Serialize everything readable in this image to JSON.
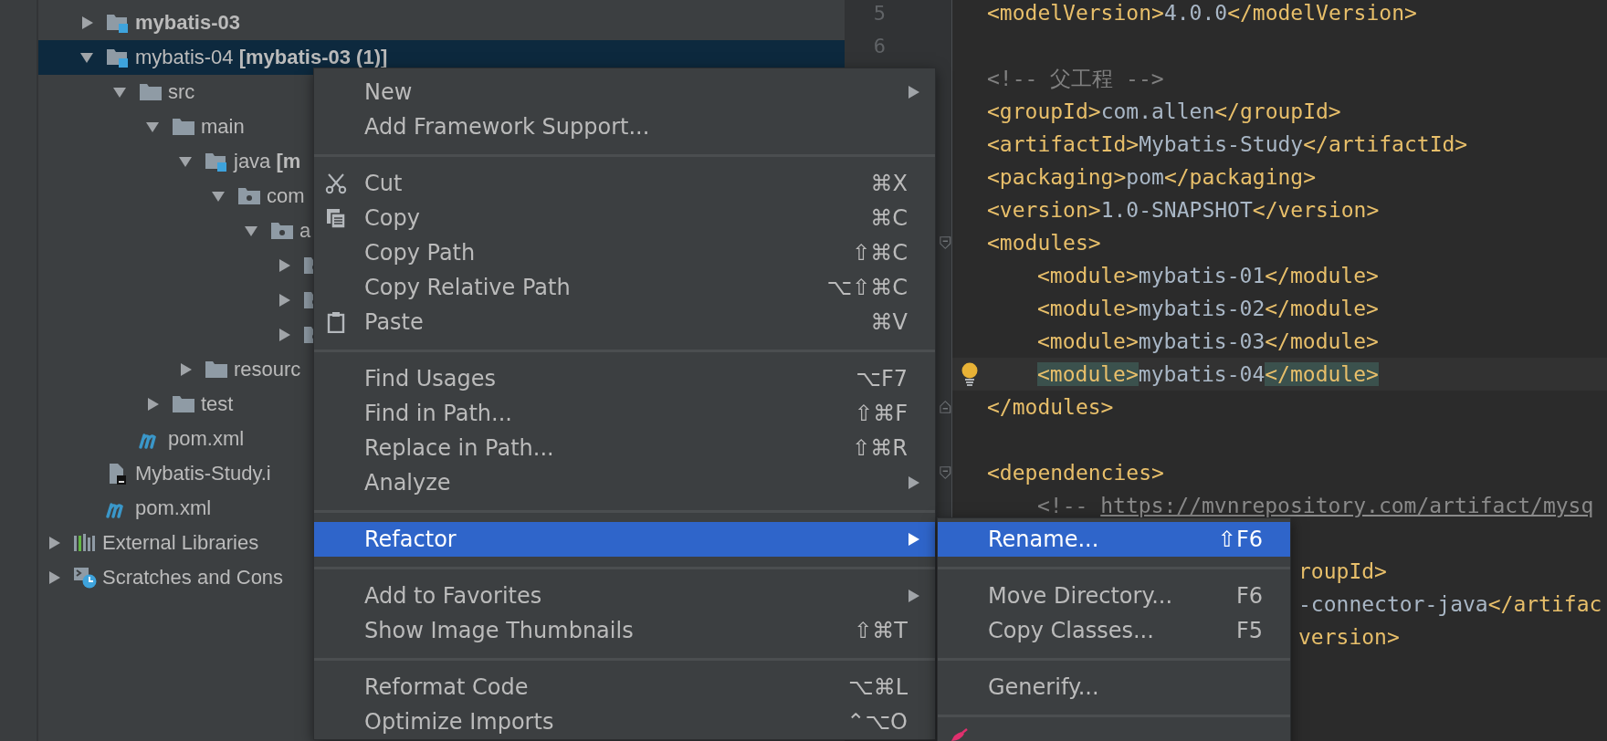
{
  "tree": {
    "items": [
      {
        "label": "mybatis-03",
        "kind": "module",
        "bold": true,
        "expanded": false,
        "selected": false
      },
      {
        "label": "mybatis-04 **[mybatis-03 (1)]**",
        "kind": "module",
        "expanded": true,
        "selected": true,
        "children": [
          {
            "label": "src",
            "kind": "folder",
            "expanded": true,
            "selected": false,
            "children": [
              {
                "label": "main",
                "kind": "folder",
                "expanded": true,
                "selected": false,
                "children": [
                  {
                    "label": "java **[m**",
                    "kind": "module",
                    "expanded": true,
                    "selected": false,
                    "children": [
                      {
                        "label": "com",
                        "kind": "package",
                        "expanded": true,
                        "selected": false,
                        "children": [
                          {
                            "label": "a",
                            "kind": "package",
                            "expanded": true,
                            "selected": false,
                            "children": [
                              {
                                "kind": "package",
                                "expanded": false,
                                "selected": false
                              },
                              {
                                "kind": "package",
                                "expanded": false,
                                "selected": false
                              },
                              {
                                "kind": "package",
                                "expanded": false,
                                "selected": false
                              }
                            ]
                          }
                        ]
                      }
                    ]
                  },
                  {
                    "label": "resourc",
                    "kind": "folder",
                    "expanded": false,
                    "selected": false
                  }
                ]
              },
              {
                "label": "test",
                "kind": "folder",
                "expanded": false,
                "selected": false
              }
            ]
          },
          {
            "label": "pom.xml",
            "kind": "maven",
            "selected": false
          }
        ]
      },
      {
        "label": "Mybatis-Study.i",
        "kind": "iml",
        "selected": false
      },
      {
        "label": "pom.xml",
        "kind": "maven",
        "selected": false
      }
    ],
    "roots": [
      {
        "label": "External Libraries",
        "kind": "libraries",
        "expanded": false,
        "selected": false
      },
      {
        "label": "Scratches and Cons",
        "kind": "scratches",
        "expanded": false,
        "selected": false
      }
    ]
  },
  "editor": {
    "lines": [
      {
        "number": "5",
        "kind": "full",
        "segments": [
          {
            "kind": "tag",
            "text": "<modelVersion>"
          },
          {
            "kind": "text",
            "text": "4.0.0"
          },
          {
            "kind": "tag",
            "text": "</modelVersion>"
          }
        ]
      },
      {
        "number": "6",
        "kind": "blank"
      },
      {
        "kind": "full",
        "segments": [
          {
            "kind": "comment",
            "text": "<!-- 父工程 -->"
          }
        ]
      },
      {
        "kind": "full",
        "segments": [
          {
            "kind": "tag",
            "text": "<groupId>"
          },
          {
            "kind": "text",
            "text": "com.allen"
          },
          {
            "kind": "tag",
            "text": "</groupId>"
          }
        ]
      },
      {
        "kind": "full",
        "segments": [
          {
            "kind": "tag",
            "text": "<artifactId>"
          },
          {
            "kind": "text",
            "text": "Mybatis-Study"
          },
          {
            "kind": "tag",
            "text": "</artifactId>"
          }
        ]
      },
      {
        "kind": "full",
        "segments": [
          {
            "kind": "tag",
            "text": "<packaging>"
          },
          {
            "kind": "text",
            "text": "pom"
          },
          {
            "kind": "tag",
            "text": "</packaging>"
          }
        ]
      },
      {
        "kind": "full",
        "segments": [
          {
            "kind": "tag",
            "text": "<version>"
          },
          {
            "kind": "text",
            "text": "1.0-SNAPSHOT"
          },
          {
            "kind": "tag",
            "text": "</version>"
          }
        ]
      },
      {
        "kind": "full",
        "fold_start": true,
        "segments": [
          {
            "kind": "tag",
            "text": "<modules>"
          }
        ]
      },
      {
        "kind": "full",
        "nested": true,
        "segments": [
          {
            "kind": "tag",
            "text": "<module>"
          },
          {
            "kind": "text",
            "text": "mybatis-01"
          },
          {
            "kind": "tag",
            "text": "</module>"
          }
        ]
      },
      {
        "kind": "full",
        "nested": true,
        "segments": [
          {
            "kind": "tag",
            "text": "<module>"
          },
          {
            "kind": "text",
            "text": "mybatis-02"
          },
          {
            "kind": "tag",
            "text": "</module>"
          }
        ]
      },
      {
        "kind": "full",
        "nested": true,
        "segments": [
          {
            "kind": "tag",
            "text": "<module>"
          },
          {
            "kind": "text",
            "text": "mybatis-03"
          },
          {
            "kind": "tag",
            "text": "</module>"
          }
        ]
      },
      {
        "kind": "full",
        "nested": true,
        "current": true,
        "bulb": true,
        "segments": [
          {
            "kind": "match",
            "text": "<module>"
          },
          {
            "kind": "text",
            "text": "mybatis-04"
          },
          {
            "kind": "match",
            "text": "</module>"
          }
        ]
      },
      {
        "kind": "full",
        "fold_end": true,
        "segments": [
          {
            "kind": "tag",
            "text": "</modules>"
          }
        ]
      },
      {
        "kind": "blank"
      },
      {
        "kind": "full",
        "fold_start": true,
        "segments": [
          {
            "kind": "tag",
            "text": "<dependencies>"
          }
        ]
      },
      {
        "kind": "full",
        "nested": true,
        "segments": [
          {
            "kind": "comment",
            "text": "<!-- "
          },
          {
            "kind": "link",
            "text": "https://mvnrepository.com/artifact/mysq"
          }
        ]
      },
      {
        "kind": "blank"
      },
      {
        "kind": "partial",
        "segments": [
          {
            "kind": "tag",
            "text": "roupId>"
          }
        ]
      },
      {
        "kind": "partial",
        "segments": [
          {
            "kind": "text",
            "text": "-connector-java"
          },
          {
            "kind": "tag",
            "text": "</artifac"
          }
        ]
      },
      {
        "kind": "partial",
        "segments": [
          {
            "kind": "tag",
            "text": "version>"
          }
        ]
      }
    ]
  },
  "context_menu": {
    "items": [
      {
        "kind": "plain",
        "label": "New",
        "submenu": true,
        "selected": false
      },
      {
        "kind": "plain",
        "label": "Add Framework Support...",
        "selected": false
      },
      {
        "kind": "separator"
      },
      {
        "kind": "scissors",
        "label": "Cut",
        "shortcut": "⌘X",
        "selected": false
      },
      {
        "kind": "copy",
        "label": "Copy",
        "shortcut": "⌘C",
        "selected": false
      },
      {
        "kind": "plain",
        "label": "Copy Path",
        "shortcut": "⇧⌘C",
        "selected": false
      },
      {
        "kind": "plain",
        "label": "Copy Relative Path",
        "shortcut": "⌥⇧⌘C",
        "selected": false
      },
      {
        "kind": "clipboard",
        "label": "Paste",
        "shortcut": "⌘V",
        "selected": false
      },
      {
        "kind": "separator"
      },
      {
        "kind": "plain",
        "label": "Find Usages",
        "shortcut": "⌥F7",
        "selected": false
      },
      {
        "kind": "plain",
        "label": "Find in Path...",
        "shortcut": "⇧⌘F",
        "selected": false
      },
      {
        "kind": "plain",
        "label": "Replace in Path...",
        "shortcut": "⇧⌘R",
        "selected": false
      },
      {
        "kind": "plain",
        "label": "Analyze",
        "submenu": true,
        "selected": false
      },
      {
        "kind": "separator"
      },
      {
        "kind": "plain",
        "label": "Refactor",
        "submenu": true,
        "selected": true
      },
      {
        "kind": "separator"
      },
      {
        "kind": "plain",
        "label": "Add to Favorites",
        "submenu": true,
        "selected": false
      },
      {
        "kind": "plain",
        "label": "Show Image Thumbnails",
        "shortcut": "⇧⌘T",
        "selected": false
      },
      {
        "kind": "separator"
      },
      {
        "kind": "plain",
        "label": "Reformat Code",
        "shortcut": "⌥⌘L",
        "selected": false
      },
      {
        "kind": "plain",
        "label": "Optimize Imports",
        "shortcut": "⌃⌥O",
        "selected": false
      }
    ]
  },
  "refactor_submenu": {
    "items": [
      {
        "kind": "plain",
        "label": "Rename...",
        "shortcut": "⇧F6",
        "selected": true
      },
      {
        "kind": "separator"
      },
      {
        "kind": "plain",
        "label": "Move Directory...",
        "shortcut": "F6",
        "selected": false
      },
      {
        "kind": "plain",
        "label": "Copy Classes...",
        "shortcut": "F5",
        "selected": false
      },
      {
        "kind": "separator"
      },
      {
        "kind": "plain",
        "label": "Generify...",
        "selected": false
      },
      {
        "kind": "separator"
      },
      {
        "kind": "pepper",
        "selected": false
      }
    ]
  }
}
